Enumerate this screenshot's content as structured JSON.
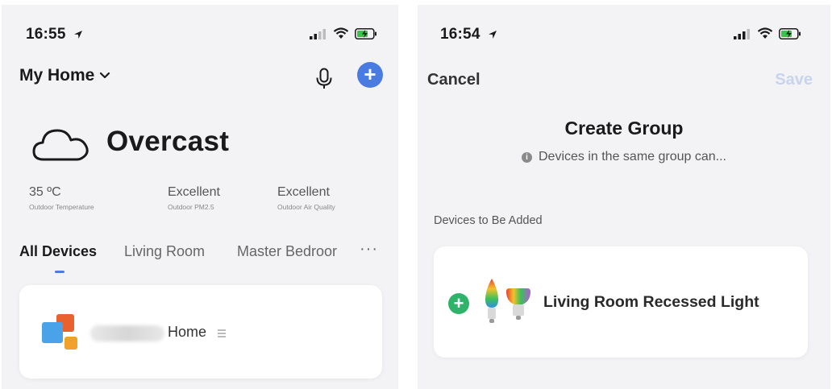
{
  "left_screen": {
    "status_time": "16:55",
    "home_title": "My Home",
    "weather": {
      "condition": "Overcast"
    },
    "stats": [
      {
        "value": "35 ºC",
        "label": "Outdoor Temperature"
      },
      {
        "value": "Excellent",
        "label": "Outdoor PM2.5"
      },
      {
        "value": "Excellent",
        "label": "Outdoor Air Quality"
      }
    ],
    "tabs": [
      {
        "label": "All Devices",
        "active": true
      },
      {
        "label": "Living Room",
        "active": false
      },
      {
        "label": "Master Bedroor",
        "active": false
      }
    ],
    "more": "···",
    "device_card": {
      "name": "Home"
    }
  },
  "right_screen": {
    "status_time": "16:54",
    "cancel_label": "Cancel",
    "save_label": "Save",
    "title": "Create Group",
    "info_text": "Devices in the same group can...",
    "section_label": "Devices to Be Added",
    "device": {
      "name": "Living Room Recessed Light"
    }
  },
  "colors": {
    "accent": "#4a7be0",
    "add_green": "#2fb36b",
    "save_disabled": "#c8d4ee"
  },
  "icons": [
    "location-arrow-icon",
    "signal-icon",
    "wifi-icon",
    "battery-charging-icon",
    "chevron-down-icon",
    "microphone-icon",
    "plus-icon",
    "cloud-icon",
    "more-icon",
    "info-icon",
    "bulb-icon"
  ]
}
